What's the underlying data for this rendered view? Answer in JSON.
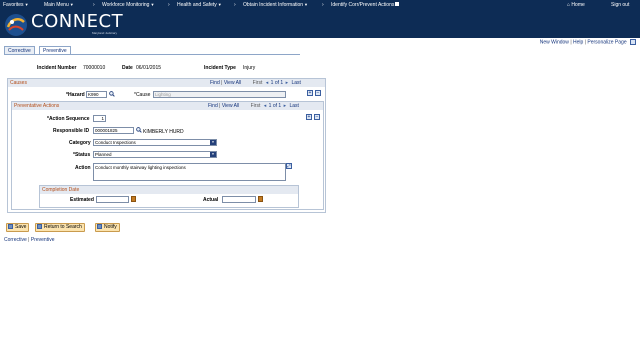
{
  "topnav": {
    "favorites": "Favorites",
    "main_menu": "Main Menu",
    "crumbs": [
      "Workforce Monitoring",
      "Health and Safety",
      "Obtain Incident Information",
      "Identify Corr/Prevent Actions"
    ],
    "home": "Home",
    "sign_out": "Sign out"
  },
  "brand": {
    "name": "CONNECT",
    "sub": "Maryland Judiciary"
  },
  "toplinks": {
    "new_window": "New Window",
    "help": "Help",
    "personalize": "Personalize Page"
  },
  "tabs": [
    "Corrective",
    "Preventive"
  ],
  "incident": {
    "number_label": "Incident Number",
    "number": "70000010",
    "date_label": "Date",
    "date": "06/01/2015",
    "type_label": "Incident Type",
    "type": "Injury"
  },
  "causes": {
    "title": "Causes",
    "find": "Find",
    "view_all": "View All",
    "first": "First",
    "range": "1 of 1",
    "last": "Last",
    "hazard_label": "*Hazard",
    "hazard": "K990",
    "cause_label": "*Cause",
    "cause": "Lighting"
  },
  "preventative": {
    "title": "Preventative Actions",
    "find": "Find",
    "view_all": "View All",
    "first": "First",
    "range": "1 of 1",
    "last": "Last",
    "action_seq_label": "*Action Sequence",
    "action_seq": "1",
    "responsible_label": "Responsible ID",
    "responsible_id": "000001825",
    "responsible_name": "KIMBERLY HURD",
    "category_label": "Category",
    "category": "Conduct Inspections",
    "status_label": "*Status",
    "status": "Planned",
    "action_label": "Action",
    "action": "Conduct monthly stairway lighting inspections",
    "completion_title": "Completion Date",
    "estimated_label": "Estimated",
    "estimated": "",
    "actual_label": "Actual",
    "actual": ""
  },
  "buttons": {
    "save": "Save",
    "return": "Return to Search",
    "notify": "Notify"
  },
  "bottomlinks": [
    "Corrective",
    "Preventive"
  ]
}
